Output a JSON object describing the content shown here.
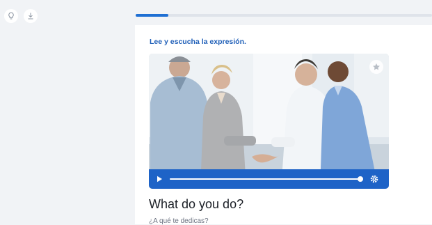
{
  "toolbar": {
    "icons": [
      "lightbulb-icon",
      "download-icon"
    ]
  },
  "lesson": {
    "progress_fraction": 0.11
  },
  "exercise": {
    "instruction": "Lee y escucha la expresión.",
    "phrase": "What do you do?",
    "translation": "¿A qué te dedicas?"
  },
  "video": {
    "progress_fraction": 1.0,
    "icons": [
      "star-icon",
      "play-icon",
      "settings-icon"
    ]
  },
  "colors": {
    "accent": "#1f6fd3",
    "instruction": "#1f5fb8",
    "player_bar": "#1e63c7",
    "background": "#f1f3f6"
  }
}
